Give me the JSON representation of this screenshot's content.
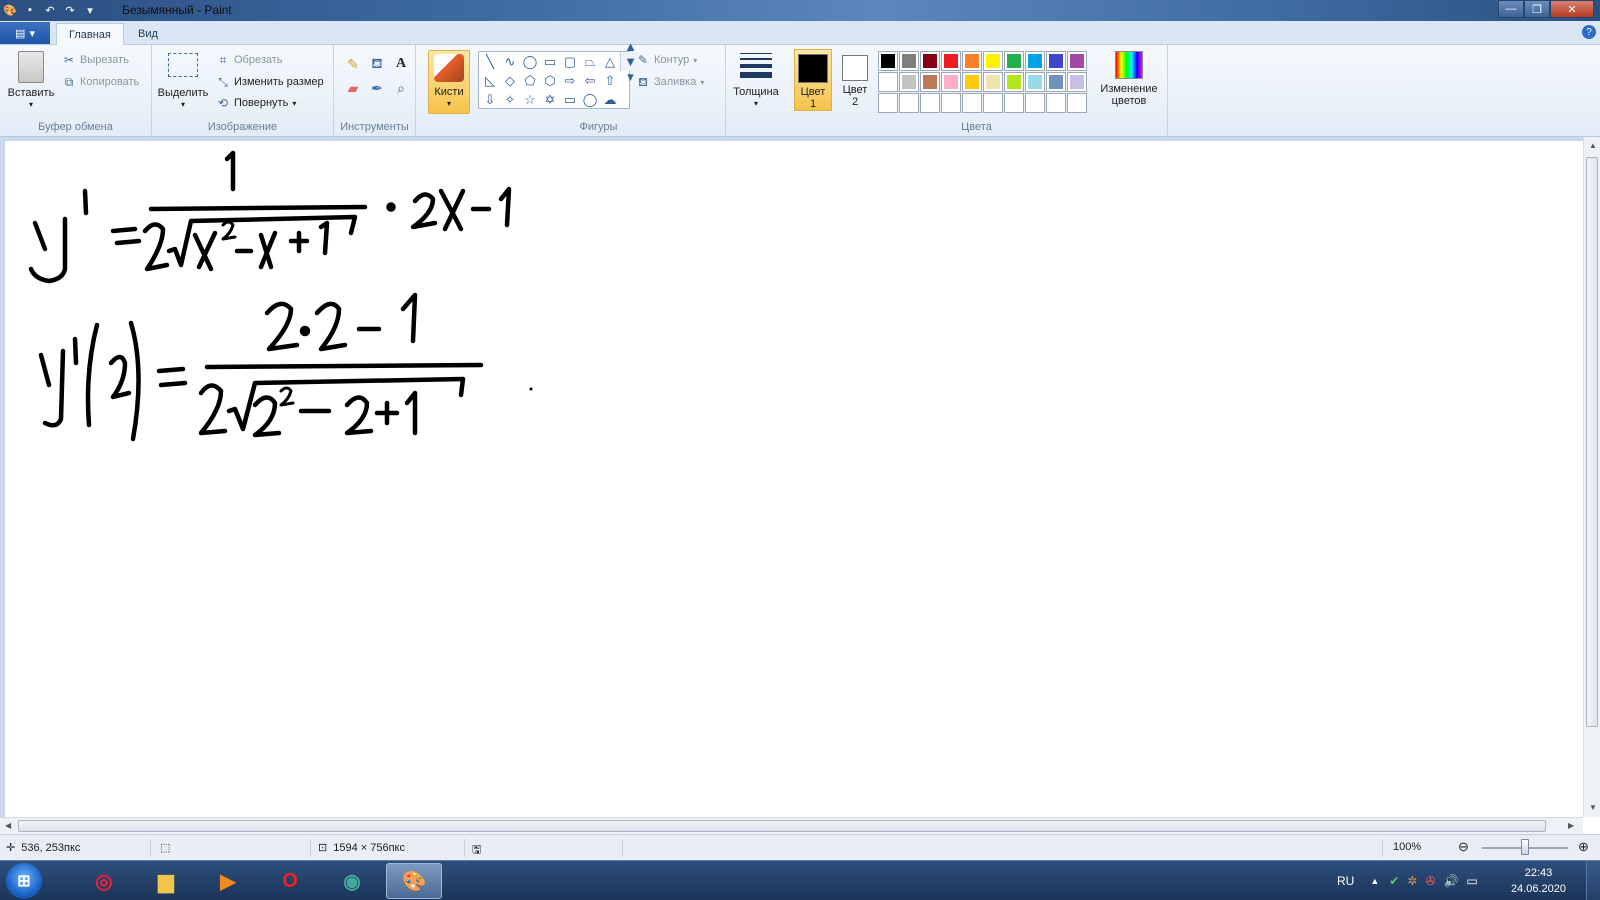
{
  "window": {
    "title": "Безымянный - Paint"
  },
  "tabs": {
    "file_icon": "menu-icon",
    "items": [
      {
        "label": "Главная",
        "active": true
      },
      {
        "label": "Вид",
        "active": false
      }
    ]
  },
  "ribbon": {
    "clipboard": {
      "title": "Буфер обмена",
      "paste": "Вставить",
      "cut": "Вырезать",
      "copy": "Копировать"
    },
    "image": {
      "title": "Изображение",
      "select": "Выделить",
      "crop": "Обрезать",
      "resize": "Изменить размер",
      "rotate": "Повернуть"
    },
    "tools": {
      "title": "Инструменты"
    },
    "brushes": {
      "label": "Кисти"
    },
    "shapes": {
      "title": "Фигуры",
      "outline": "Контур",
      "fill": "Заливка"
    },
    "size": {
      "label": "Толщина"
    },
    "colors": {
      "title": "Цвета",
      "color1_label": "Цвет 1",
      "color2_label": "Цвет 2",
      "edit_label": "Изменение цветов",
      "color1": "#000000",
      "color2": "#ffffff",
      "palette": [
        "#000000",
        "#7f7f7f",
        "#880015",
        "#ed1c24",
        "#ff7f27",
        "#fff200",
        "#22b14c",
        "#00a2e8",
        "#3f48cc",
        "#a349a4",
        "#ffffff",
        "#c3c3c3",
        "#b97a57",
        "#ffaec9",
        "#ffc90e",
        "#efe4b0",
        "#b5e61d",
        "#99d9ea",
        "#7092be",
        "#c8bfe7",
        "#ffffff",
        "#ffffff",
        "#ffffff",
        "#ffffff",
        "#ffffff",
        "#ffffff",
        "#ffffff",
        "#ffffff",
        "#ffffff",
        "#ffffff"
      ]
    }
  },
  "status": {
    "cursor_pos": "536, 253пкс",
    "canvas_size": "1594 × 756пкс",
    "zoom": "100%"
  },
  "taskbar": {
    "language": "RU",
    "time": "22:43",
    "date": "24.06.2020"
  }
}
